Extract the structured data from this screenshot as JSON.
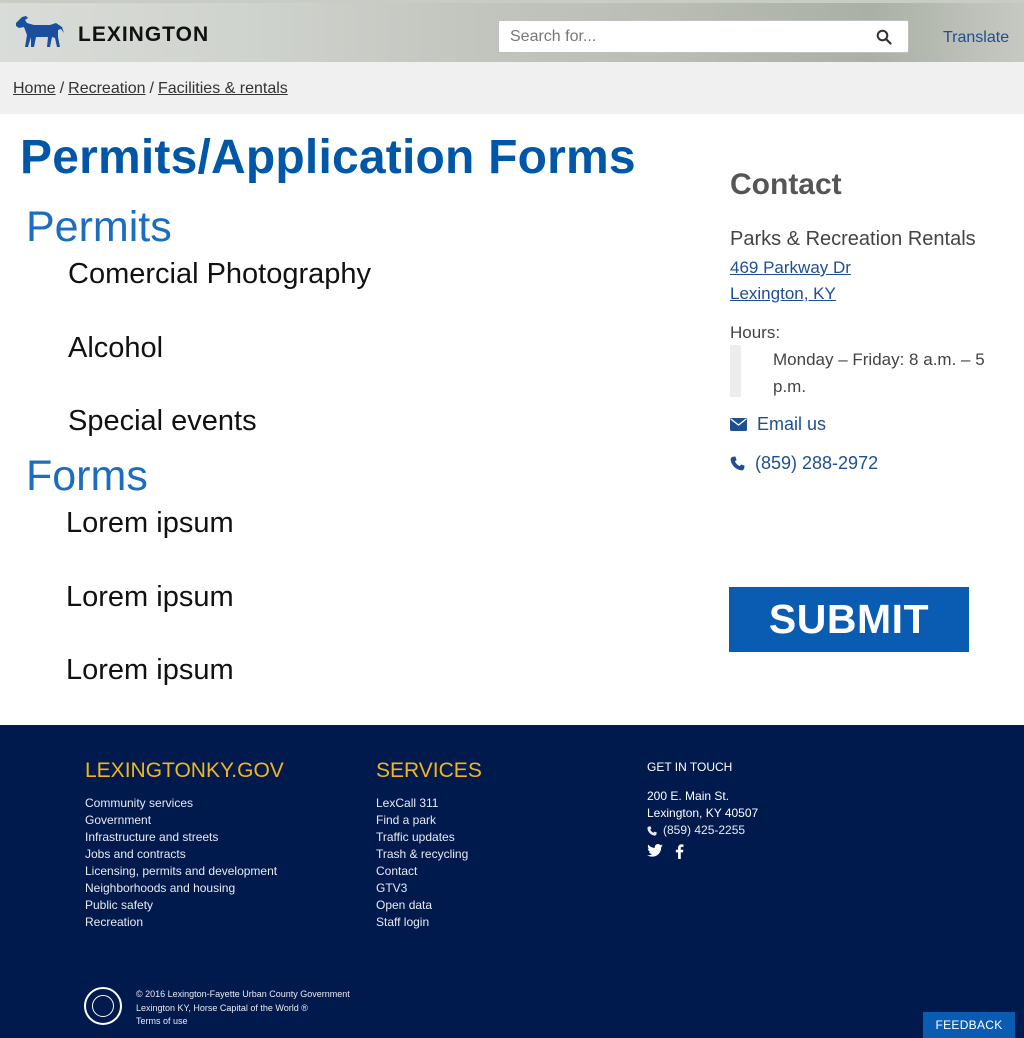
{
  "header": {
    "logo_text": "LEXINGTON",
    "search_placeholder": "Search for...",
    "translate_label": "Translate"
  },
  "breadcrumb": {
    "items": [
      "Home",
      "Recreation",
      "Facilities & rentals"
    ]
  },
  "main": {
    "title": "Permits/Application Forms",
    "permits_heading": "Permits",
    "permits": [
      "Comercial Photography",
      "Alcohol",
      "Special events"
    ],
    "forms_heading": "Forms",
    "forms": [
      "Lorem ipsum",
      "Lorem ipsum",
      "Lorem ipsum"
    ]
  },
  "contact": {
    "title": "Contact",
    "org": "Parks & Recreation Rentals",
    "address_line1": "469 Parkway Dr",
    "address_line2": "Lexington, KY",
    "hours_label": "Hours:",
    "hours_text": "Monday – Friday: 8 a.m. – 5 p.m.",
    "email_label": "Email us",
    "phone": "(859) 288-2972",
    "submit_label": "SUBMIT"
  },
  "footer": {
    "col1_heading": "LEXINGTONKY.GOV",
    "col1_links": [
      "Community services",
      "Government",
      "Infrastructure and streets",
      "Jobs and contracts",
      "Licensing, permits and development",
      "Neighborhoods and housing",
      "Public safety",
      "Recreation"
    ],
    "col2_heading": "SERVICES",
    "col2_links": [
      "LexCall 311",
      "Find a park",
      "Traffic updates",
      "Trash & recycling",
      "Contact",
      "GTV3",
      "Open data",
      "Staff login"
    ],
    "col3_heading": "GET IN TOUCH",
    "address_line1": "200 E. Main St.",
    "address_line2": "Lexington, KY 40507",
    "phone": "(859) 425-2255",
    "copyright_line1": "© 2016 Lexington-Fayette Urban County Government",
    "copyright_line2": "Lexington KY, Horse Capital of the World",
    "registered_mark": "®",
    "terms": "Terms of use",
    "feedback_label": "FEEDBACK"
  },
  "colors": {
    "title_blue": "#0057a8",
    "section_blue": "#1c6dbd",
    "link_blue": "#1d4f91",
    "submit_bg": "#0a5bb2",
    "footer_bg": "#001a4e",
    "footer_heading": "#f2b51d"
  },
  "icons": [
    "horse-logo-icon",
    "search-icon",
    "envelope-icon",
    "phone-icon",
    "twitter-icon",
    "facebook-icon",
    "city-seal-icon"
  ]
}
